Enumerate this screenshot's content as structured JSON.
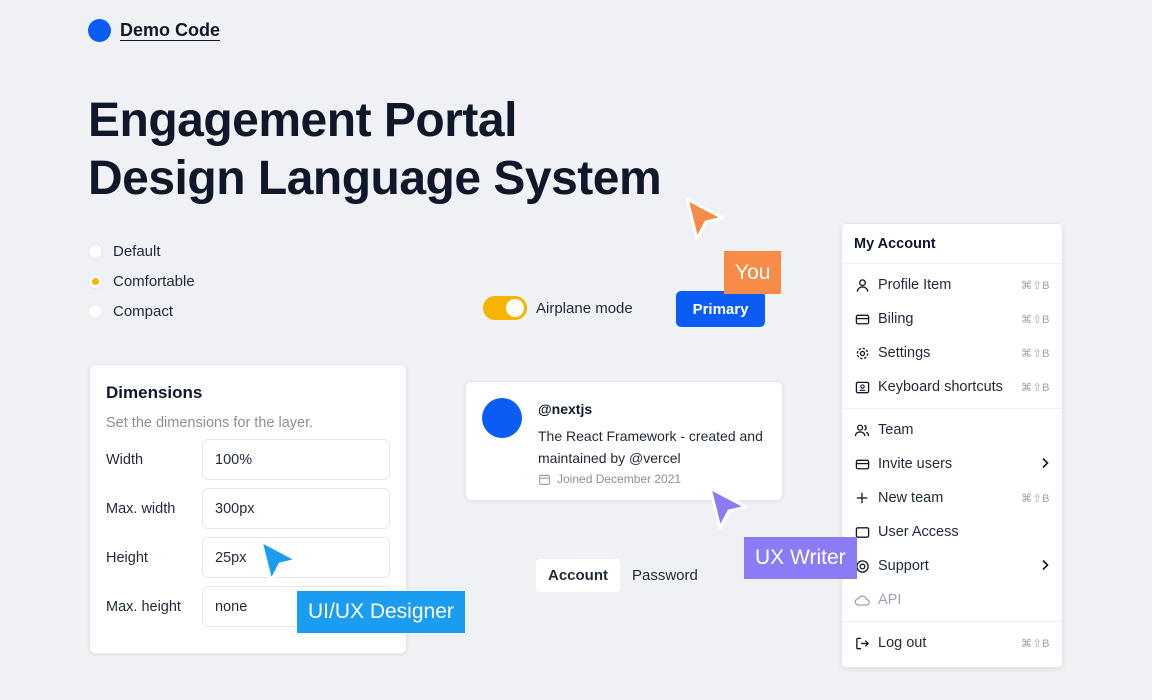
{
  "brand": {
    "name": "Demo Code",
    "color": "#0b5cf5"
  },
  "title": {
    "line1": "Engagement Portal",
    "line2": "Design Language System"
  },
  "density": {
    "options": [
      {
        "label": "Default",
        "checked": false
      },
      {
        "label": "Comfortable",
        "checked": true
      },
      {
        "label": "Compact",
        "checked": false
      }
    ]
  },
  "toggle": {
    "label": "Airplane mode",
    "on": true,
    "color": "#f5b400"
  },
  "primary_button": {
    "label": "Primary"
  },
  "dimensions": {
    "title": "Dimensions",
    "subtitle": "Set the dimensions for the layer.",
    "fields": [
      {
        "label": "Width",
        "value": "100%"
      },
      {
        "label": "Max. width",
        "value": "300px"
      },
      {
        "label": "Height",
        "value": "25px"
      },
      {
        "label": "Max. height",
        "value": "none"
      }
    ]
  },
  "profile": {
    "handle": "@nextjs",
    "description": "The React Framework - created and maintained by @vercel",
    "joined": "Joined December 2021"
  },
  "tabs": [
    {
      "label": "Account",
      "active": true
    },
    {
      "label": "Password",
      "active": false
    }
  ],
  "menu": {
    "title": "My Account",
    "groups": [
      [
        {
          "label": "Profile Item",
          "icon": "user-icon",
          "shortcut": "⌘⇧B"
        },
        {
          "label": "Biling",
          "icon": "credit-card-icon",
          "shortcut": "⌘⇧B"
        },
        {
          "label": "Settings",
          "icon": "gear-icon",
          "shortcut": "⌘⇧B"
        },
        {
          "label": "Keyboard shortcuts",
          "icon": "keyboard-icon",
          "shortcut": "⌘⇧B"
        }
      ],
      [
        {
          "label": "Team",
          "icon": "users-icon"
        },
        {
          "label": "Invite users",
          "icon": "mail-icon",
          "submenu": true
        },
        {
          "label": "New team",
          "icon": "plus-icon",
          "shortcut": "⌘⇧B"
        },
        {
          "label": "User Access",
          "icon": "access-icon"
        },
        {
          "label": "Support",
          "icon": "support-icon",
          "submenu": true
        },
        {
          "label": "API",
          "icon": "cloud-icon",
          "disabled": true
        }
      ],
      [
        {
          "label": "Log out",
          "icon": "logout-icon",
          "shortcut": "⌘⇧B"
        }
      ]
    ]
  },
  "cursors": {
    "you": {
      "label": "You",
      "color": "#f78c48"
    },
    "ux_writer": {
      "label": "UX Writer",
      "color": "#8b7cf6"
    },
    "ui_ux_designer": {
      "label": "UI/UX Designer",
      "color": "#1a9cf0"
    }
  }
}
